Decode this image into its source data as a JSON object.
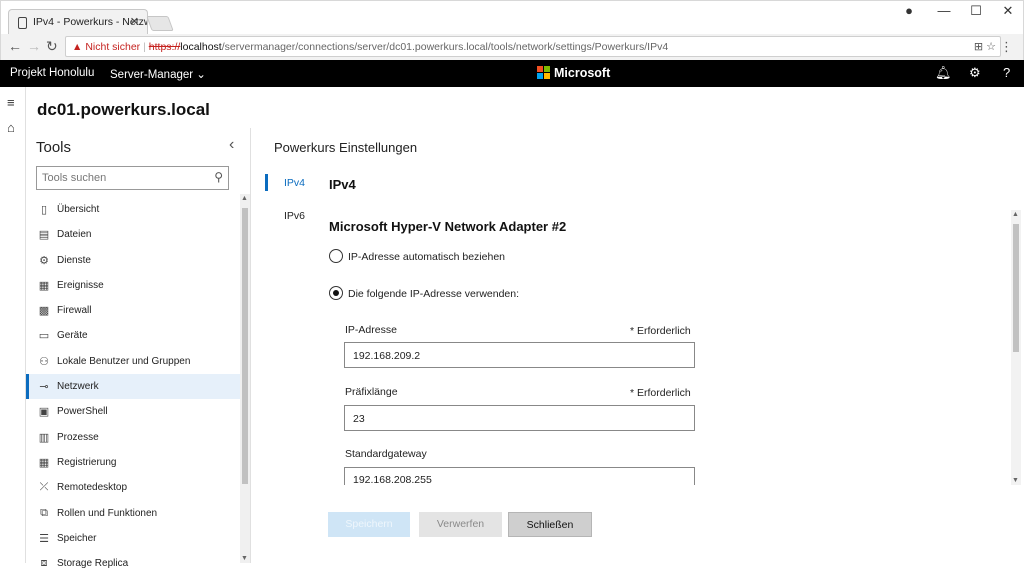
{
  "browser": {
    "tab_title": "IPv4 - Powerkurs - Netzw",
    "tab_close": "✕",
    "warning_text": "Nicht sicher",
    "url_scheme": "https://",
    "url_host": "localhost",
    "url_path": "/servermanager/connections/server/dc01.powerkurs.local/tools/network/settings/Powerkurs/IPv4"
  },
  "header": {
    "brand": "Projekt Honolulu",
    "app_switcher": "Server-Manager",
    "company": "Microsoft"
  },
  "server_name": "dc01.powerkurs.local",
  "tools": {
    "title": "Tools",
    "search_placeholder": "Tools suchen",
    "items": [
      {
        "label": "Übersicht",
        "icon": "▯"
      },
      {
        "label": "Dateien",
        "icon": "▤"
      },
      {
        "label": "Dienste",
        "icon": "⚙"
      },
      {
        "label": "Ereignisse",
        "icon": "▦"
      },
      {
        "label": "Firewall",
        "icon": "▩"
      },
      {
        "label": "Geräte",
        "icon": "▭"
      },
      {
        "label": "Lokale Benutzer und Gruppen",
        "icon": "⚇"
      },
      {
        "label": "Netzwerk",
        "icon": "⊸"
      },
      {
        "label": "PowerShell",
        "icon": "▣"
      },
      {
        "label": "Prozesse",
        "icon": "▥"
      },
      {
        "label": "Registrierung",
        "icon": "▦"
      },
      {
        "label": "Remotedesktop",
        "icon": "⤫"
      },
      {
        "label": "Rollen und Funktionen",
        "icon": "⧉"
      },
      {
        "label": "Speicher",
        "icon": "☰"
      },
      {
        "label": "Storage Replica",
        "icon": "⧈"
      }
    ],
    "active_item": "Netzwerk"
  },
  "settings": {
    "title": "Powerkurs Einstellungen",
    "tabs": [
      "IPv4",
      "IPv6"
    ],
    "active_tab": "IPv4",
    "section": "IPv4",
    "adapter": "Microsoft Hyper-V Network Adapter #2",
    "radio_auto": "IP-Adresse automatisch beziehen",
    "radio_manual": "Die folgende IP-Adresse verwenden:",
    "radio_selected": "manual",
    "fields": {
      "ip_label": "IP-Adresse",
      "ip_required": "* Erforderlich",
      "ip_value": "192.168.209.2",
      "prefix_label": "Präfixlänge",
      "prefix_required": "* Erforderlich",
      "prefix_value": "23",
      "gateway_label": "Standardgateway",
      "gateway_value": "192.168.208.255"
    },
    "buttons": {
      "save": "Speichern",
      "discard": "Verwerfen",
      "close": "Schließen"
    }
  },
  "colors": {
    "accent": "#0b6cbf",
    "header_bg": "#000000",
    "warning": "#c5221f"
  }
}
